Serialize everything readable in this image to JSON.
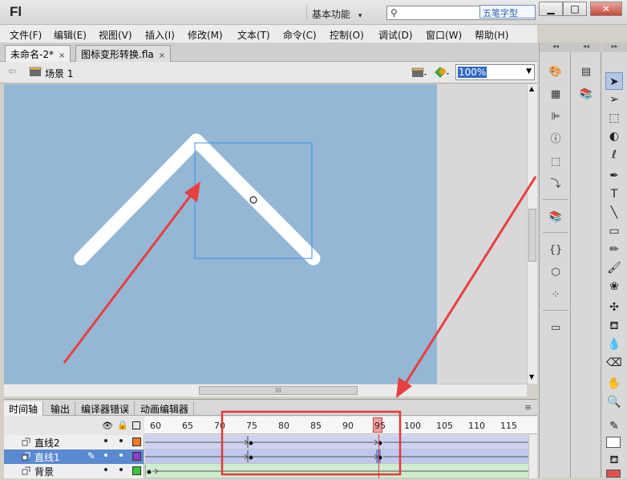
{
  "app": {
    "logo": "Fl",
    "workspace": "基本功能",
    "workspace_arrow": "▾",
    "search_placeholder": "",
    "watermark": "五笔字型"
  },
  "window": {
    "minimize": "▁",
    "maximize": "□",
    "close": "✕"
  },
  "menu": [
    "文件(F)",
    "编辑(E)",
    "视图(V)",
    "插入(I)",
    "修改(M)",
    "文本(T)",
    "命令(C)",
    "控制(O)",
    "调试(D)",
    "窗口(W)",
    "帮助(H)"
  ],
  "doc_tabs": [
    {
      "label": "未命名-2*",
      "close": "×"
    },
    {
      "label": "图标变形转换.fla",
      "close": "×"
    }
  ],
  "scene": {
    "back_arrow": "⇦",
    "label": "场景 1"
  },
  "zoom": {
    "value": "100%",
    "arrow": "▼"
  },
  "timeline": {
    "tabs": [
      "时间轴",
      "输出",
      "编译器错误",
      "动画编辑器"
    ],
    "menu_icon": "≡",
    "ruler": [
      "60",
      "65",
      "70",
      "75",
      "80",
      "85",
      "90",
      "95",
      "100",
      "105",
      "110",
      "115"
    ],
    "current_frame": 95,
    "layers": [
      {
        "name": "直线2",
        "color": "#f07a20",
        "selected": false
      },
      {
        "name": "直线1",
        "color": "#8a3fc8",
        "selected": true
      },
      {
        "name": "背景",
        "color": "#3bc43b",
        "selected": false
      }
    ]
  },
  "colors": {
    "stage": "#94b7d5",
    "highlight_box": "#e0393a",
    "arrow": "#e84040",
    "selection": "#3a8fe8"
  },
  "hscroll_grip": "III",
  "vscroll_grip": "≡"
}
